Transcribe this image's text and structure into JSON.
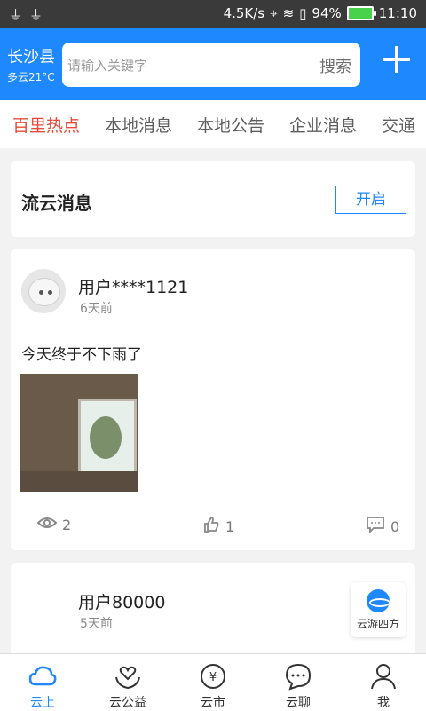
{
  "status_bar": {
    "left_icons": [
      "usb-icon",
      "usb-icon"
    ],
    "network_speed": "4.5K/s",
    "battery": "94%",
    "time": "11:10"
  },
  "header": {
    "city": "长沙县",
    "weather": "多云21°C",
    "search_placeholder": "请输入关键字",
    "search_button": "搜索"
  },
  "tabs": [
    {
      "label": "百里热点",
      "active": true
    },
    {
      "label": "本地消息"
    },
    {
      "label": "本地公告"
    },
    {
      "label": "企业消息"
    },
    {
      "label": "交通"
    }
  ],
  "message_card": {
    "title": "流云消息",
    "button": "开启"
  },
  "posts": [
    {
      "user": "用户****1121",
      "time": "6天前",
      "content": "今天终于不下雨了",
      "views": "2",
      "likes": "1",
      "comments": "0"
    },
    {
      "user": "用户80000",
      "time": "5天前"
    }
  ],
  "floating": {
    "label": "云游四方"
  },
  "bottom_nav": [
    {
      "label": "云上",
      "active": true
    },
    {
      "label": "云公益"
    },
    {
      "label": "云市"
    },
    {
      "label": "云聊"
    },
    {
      "label": "我"
    }
  ],
  "colors": {
    "primary": "#1e88ff",
    "active_tab": "#e64b3b"
  }
}
